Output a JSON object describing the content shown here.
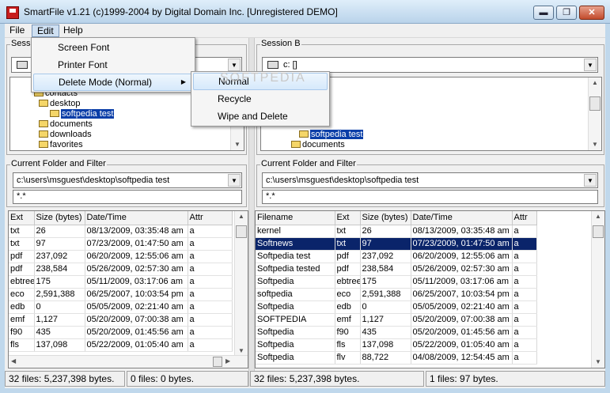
{
  "window": {
    "title": "SmartFile v1.21   (c)1999-2004 by Digital Domain Inc. [Unregistered DEMO]",
    "min_glyph": "▬",
    "max_glyph": "❐",
    "close_glyph": "✕"
  },
  "menubar": {
    "file": "File",
    "edit": "Edit",
    "help": "Help"
  },
  "edit_menu": {
    "items": [
      "Screen Font",
      "Printer Font",
      "Delete Mode (Normal)"
    ],
    "submenu_arrow": "▶"
  },
  "delete_submenu": {
    "items": [
      "Normal",
      "Recycle",
      "Wipe and Delete"
    ]
  },
  "watermark": "SOFTPEDIA",
  "arrows": {
    "down": "▼",
    "up": "▲",
    "left": "◀",
    "right": "▶"
  },
  "session_a": {
    "legend": "Sessi",
    "drive_value": "",
    "tree": [
      "contacts",
      "desktop",
      "softpedia test",
      "documents",
      "downloads",
      "favorites"
    ],
    "filter_legend": "Current Folder and Filter",
    "path": "c:\\users\\msguest\\desktop\\softpedia test",
    "filter": "*.*",
    "columns": [
      "Ext",
      "Size (bytes)",
      "Date/Time",
      "Attr"
    ],
    "rows": [
      [
        "txt",
        "26",
        "08/13/2009, 03:35:48 am",
        "a"
      ],
      [
        "txt",
        "97",
        "07/23/2009, 01:47:50 am",
        "a"
      ],
      [
        "pdf",
        "237,092",
        "06/20/2009, 12:55:06 am",
        "a"
      ],
      [
        "pdf",
        "238,584",
        "05/26/2009, 02:57:30 am",
        "a"
      ],
      [
        "ebtree",
        "175",
        "05/11/2009, 03:17:06 am",
        "a"
      ],
      [
        "eco",
        "2,591,388",
        "06/25/2007, 10:03:54 pm",
        "a"
      ],
      [
        "edb",
        "0",
        "05/05/2009, 02:21:40 am",
        "a"
      ],
      [
        "emf",
        "1,127",
        "05/20/2009, 07:00:38 am",
        "a"
      ],
      [
        "f90",
        "435",
        "05/20/2009, 01:45:56 am",
        "a"
      ],
      [
        "fls",
        "137,098",
        "05/22/2009, 01:05:40 am",
        "a"
      ]
    ],
    "status_total": "32 files: 5,237,398 bytes.",
    "status_selected": "0 files: 0 bytes."
  },
  "session_b": {
    "legend": "Session B",
    "drive_value": "c: []",
    "tree": [
      "softpedia test",
      "documents"
    ],
    "filter_legend": "Current Folder and Filter",
    "path": "c:\\users\\msguest\\desktop\\softpedia test",
    "filter": "*.*",
    "columns": [
      "Filename",
      "Ext",
      "Size (bytes)",
      "Date/Time",
      "Attr"
    ],
    "rows": [
      [
        "kernel",
        "txt",
        "26",
        "08/13/2009, 03:35:48 am",
        "a"
      ],
      [
        "Softnews",
        "txt",
        "97",
        "07/23/2009, 01:47:50 am",
        "a"
      ],
      [
        "Softpedia test",
        "pdf",
        "237,092",
        "06/20/2009, 12:55:06 am",
        "a"
      ],
      [
        "Softpedia tested",
        "pdf",
        "238,584",
        "05/26/2009, 02:57:30 am",
        "a"
      ],
      [
        "Softpedia",
        "ebtree",
        "175",
        "05/11/2009, 03:17:06 am",
        "a"
      ],
      [
        "softpedia",
        "eco",
        "2,591,388",
        "06/25/2007, 10:03:54 pm",
        "a"
      ],
      [
        "Softpedia",
        "edb",
        "0",
        "05/05/2009, 02:21:40 am",
        "a"
      ],
      [
        "SOFTPEDIA",
        "emf",
        "1,127",
        "05/20/2009, 07:00:38 am",
        "a"
      ],
      [
        "Softpedia",
        "f90",
        "435",
        "05/20/2009, 01:45:56 am",
        "a"
      ],
      [
        "Softpedia",
        "fls",
        "137,098",
        "05/22/2009, 01:05:40 am",
        "a"
      ],
      [
        "Softpedia",
        "flv",
        "88,722",
        "04/08/2009, 12:54:45 am",
        "a"
      ]
    ],
    "status_total": "32 files: 5,237,398 bytes.",
    "status_selected": "1 files: 97 bytes."
  }
}
